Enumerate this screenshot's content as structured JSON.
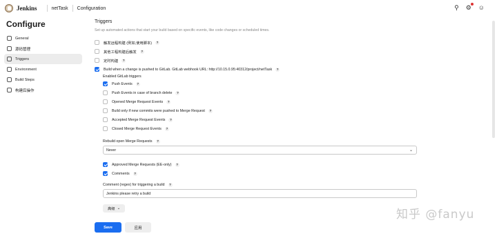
{
  "header": {
    "brand": "Jenkins",
    "breadcrumbs": [
      "netTask",
      "Configuration"
    ],
    "icons": [
      "search-icon",
      "bell-icon",
      "user-icon"
    ]
  },
  "sidebar": {
    "title": "Configure",
    "items": [
      {
        "label": "General",
        "icon": "gear-icon"
      },
      {
        "label": "源码管理",
        "icon": "source-icon"
      },
      {
        "label": "Triggers",
        "icon": "clock-icon"
      },
      {
        "label": "Environment",
        "icon": "globe-icon"
      },
      {
        "label": "Build Steps",
        "icon": "steps-icon"
      },
      {
        "label": "构建后操作",
        "icon": "cube-icon"
      }
    ],
    "active_index": 2
  },
  "triggers": {
    "title": "Triggers",
    "description": "Set up automated actions that start your build based on specific events, like code changes or scheduled times.",
    "options": [
      {
        "label": "触发远程构建 (例如,使用脚本)",
        "checked": false
      },
      {
        "label": "其他工程构建后触发",
        "checked": false
      },
      {
        "label": "定时构建",
        "checked": false
      },
      {
        "label": "Build when a change is pushed to GitLab. GitLab webhook URL: http://10.15.0.95:40312/project/netTask",
        "checked": true
      }
    ],
    "gitlab": {
      "label": "Enabled GitLab triggers",
      "events": [
        {
          "label": "Push Events",
          "checked": true
        },
        {
          "label": "Push Events in case of branch delete",
          "checked": false
        },
        {
          "label": "Opened Merge Request Events",
          "checked": false
        },
        {
          "label": "Build only if new commits were pushed to Merge Request",
          "checked": false
        },
        {
          "label": "Accepted Merge Request Events",
          "checked": false
        },
        {
          "label": "Closed Merge Request Events",
          "checked": false
        }
      ],
      "rebuild_label": "Rebuild open Merge Requests",
      "rebuild_value": "Never",
      "extra": [
        {
          "label": "Approved Merge Requests (EE-only)",
          "checked": true
        },
        {
          "label": "Comments",
          "checked": true
        }
      ],
      "comment_label": "Comment (regex) for triggering a build",
      "comment_value": "Jenkins please retry a build",
      "advanced_label": "高级"
    }
  },
  "footer": {
    "save_label": "Save",
    "apply_label": "应用"
  },
  "watermark": "知乎 @fanyu",
  "colors": {
    "accent": "#1a6df0"
  }
}
